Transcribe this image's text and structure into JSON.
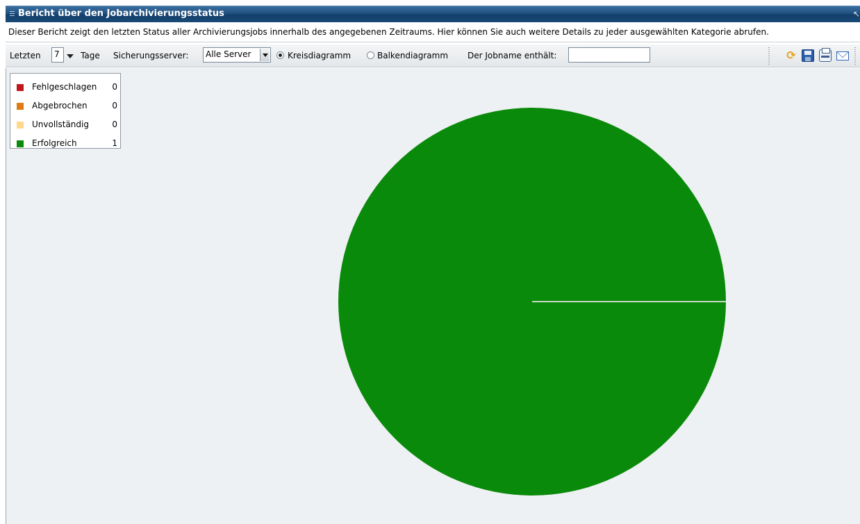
{
  "window": {
    "title": "Bericht über den Jobarchivierungsstatus",
    "description": "Dieser Bericht zeigt den letzten Status aller Archivierungsjobs innerhalb des angegebenen Zeitraums. Hier können Sie auch weitere Details zu jeder ausgewählten Kategorie abrufen."
  },
  "toolbar": {
    "last_label": "Letzten",
    "days_value": "7",
    "days_label": "Tage",
    "server_label": "Sicherungsserver:",
    "server_value": "Alle Server",
    "pie_label": "Kreisdiagramm",
    "bar_label": "Balkendiagramm",
    "jobname_label": "Der Jobname enthält:",
    "jobname_value": "",
    "selected_chart": "pie",
    "icons": [
      "refresh-icon",
      "save-icon",
      "print-icon",
      "mail-icon"
    ]
  },
  "legend": [
    {
      "label": "Fehlgeschlagen",
      "value": "0",
      "color": "#c0181a"
    },
    {
      "label": "Abgebrochen",
      "value": "0",
      "color": "#e07b12"
    },
    {
      "label": "Unvollständig",
      "value": "0",
      "color": "#ffd98a"
    },
    {
      "label": "Erfolgreich",
      "value": "1",
      "color": "#0a8a0a"
    }
  ],
  "chart_data": {
    "type": "pie",
    "categories": [
      "Fehlgeschlagen",
      "Abgebrochen",
      "Unvollständig",
      "Erfolgreich"
    ],
    "values": [
      0,
      0,
      0,
      1
    ],
    "colors": [
      "#c0181a",
      "#e07b12",
      "#ffd98a",
      "#0a8a0a"
    ],
    "legend_position": "top-left"
  }
}
